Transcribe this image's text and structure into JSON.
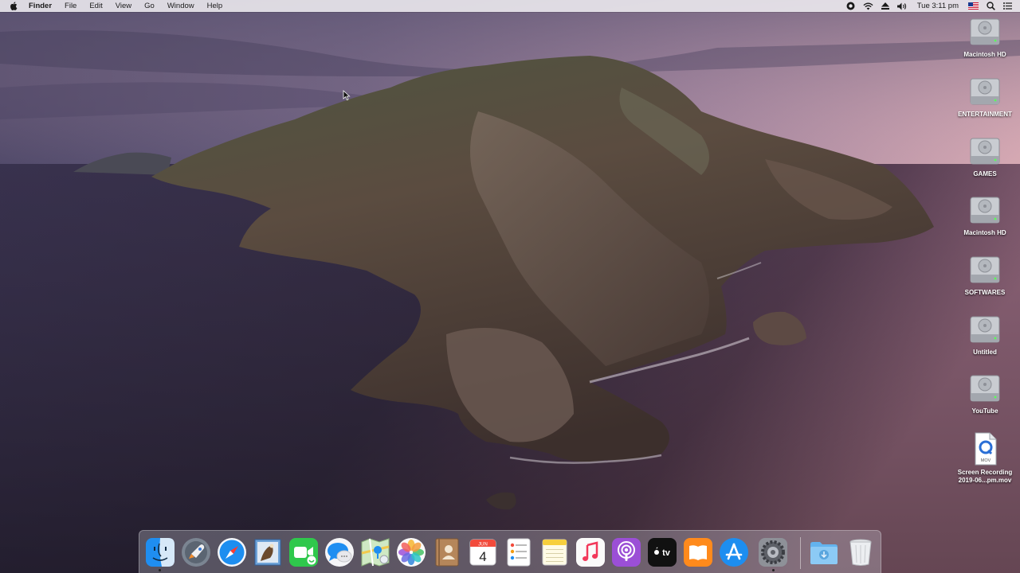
{
  "menubar": {
    "app_name": "Finder",
    "menus": [
      "File",
      "Edit",
      "View",
      "Go",
      "Window",
      "Help"
    ],
    "clock": "Tue 3:11 pm",
    "status_icons": [
      "screen-record-icon",
      "wifi-icon",
      "eject-icon",
      "volume-icon",
      "clock",
      "flag-icon",
      "spotlight-search-icon",
      "notification-center-icon"
    ]
  },
  "desktop": {
    "icons": [
      {
        "label": "Macintosh HD",
        "type": "drive"
      },
      {
        "label": "ENTERTAINMENT",
        "type": "drive"
      },
      {
        "label": "GAMES",
        "type": "drive"
      },
      {
        "label": "Macintosh HD",
        "type": "drive"
      },
      {
        "label": "SOFTWARES",
        "type": "drive"
      },
      {
        "label": "Untitled",
        "type": "drive"
      },
      {
        "label": "YouTube",
        "type": "drive"
      },
      {
        "label": "Screen Recording\n2019-06...pm.mov",
        "type": "movie-file"
      }
    ]
  },
  "dock": {
    "items": [
      {
        "name": "finder",
        "icon": "finder-icon",
        "running": true
      },
      {
        "name": "launchpad",
        "icon": "launchpad-icon",
        "running": false
      },
      {
        "name": "safari",
        "icon": "safari-icon",
        "running": false
      },
      {
        "name": "mail",
        "icon": "mail-icon",
        "running": false
      },
      {
        "name": "facetime",
        "icon": "facetime-icon",
        "running": false
      },
      {
        "name": "messages",
        "icon": "messages-icon",
        "running": false
      },
      {
        "name": "maps",
        "icon": "maps-icon",
        "running": false
      },
      {
        "name": "photos",
        "icon": "photos-icon",
        "running": false
      },
      {
        "name": "contacts",
        "icon": "contacts-icon",
        "running": false
      },
      {
        "name": "calendar",
        "icon": "calendar-icon",
        "running": false
      },
      {
        "name": "reminders",
        "icon": "reminders-icon",
        "running": false
      },
      {
        "name": "notes",
        "icon": "notes-icon",
        "running": false
      },
      {
        "name": "music",
        "icon": "music-icon",
        "running": false
      },
      {
        "name": "podcasts",
        "icon": "podcasts-icon",
        "running": false
      },
      {
        "name": "tv",
        "icon": "apple-tv-icon",
        "running": false
      },
      {
        "name": "books",
        "icon": "books-icon",
        "running": false
      },
      {
        "name": "app-store",
        "icon": "app-store-icon",
        "running": false
      },
      {
        "name": "system-preferences",
        "icon": "gear-icon",
        "running": true
      },
      {
        "name": "downloads",
        "icon": "downloads-folder-icon",
        "running": false
      },
      {
        "name": "trash",
        "icon": "trash-icon",
        "running": false
      }
    ],
    "calendar_month": "JUN",
    "calendar_day": "4",
    "tv_label": "tv",
    "movie_badge": "MOV"
  },
  "colors": {
    "finder_blue": "#1f8ef1",
    "menubar_bg": "#eeecf0",
    "sea_dark": "#2a2436",
    "sky_pink": "#c99aa7"
  }
}
